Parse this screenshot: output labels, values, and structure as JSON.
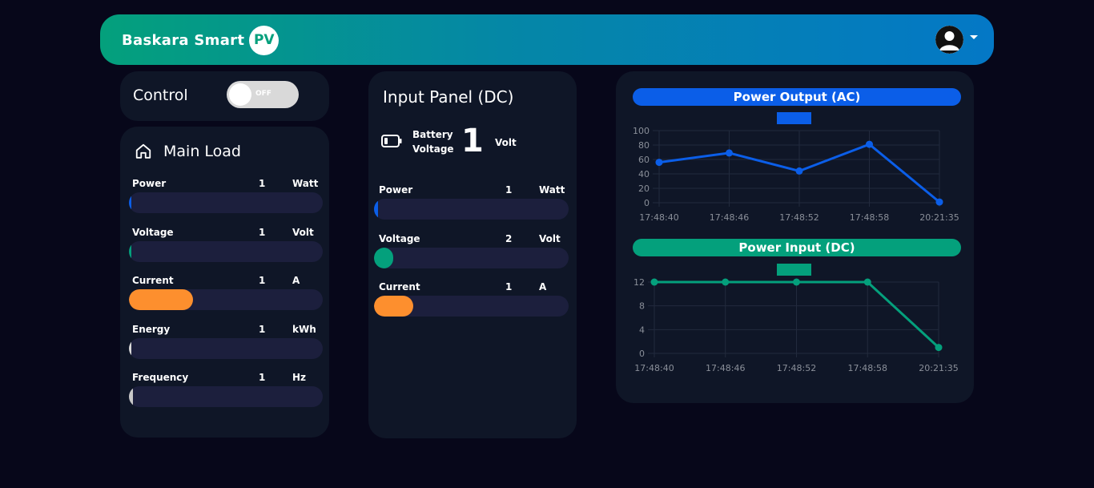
{
  "header": {
    "brand_text": "Baskara Smart",
    "brand_badge": "PV",
    "accent_start": "#04a07c",
    "accent_end": "#0478c6"
  },
  "control": {
    "title": "Control",
    "toggle_label": "OFF",
    "toggle_state": "off"
  },
  "main_load": {
    "title": "Main Load",
    "icon": "home-icon",
    "metrics": [
      {
        "label": "Power",
        "value": "1",
        "unit": "Watt",
        "level": 0.01,
        "color": "#0b5ee8"
      },
      {
        "label": "Voltage",
        "value": "1",
        "unit": "Volt",
        "level": 0.01,
        "color": "#04a07c"
      },
      {
        "label": "Current",
        "value": "1",
        "unit": "A",
        "level": 0.33,
        "color": "#fd8f2e"
      },
      {
        "label": "Energy",
        "value": "1",
        "unit": "kWh",
        "level": 0.01,
        "color": "#d9d9d9"
      },
      {
        "label": "Frequency",
        "value": "1",
        "unit": "Hz",
        "level": 0.02,
        "color": "#c8c8c8"
      }
    ]
  },
  "input_panel": {
    "title": "Input Panel (DC)",
    "battery_label_1": "Battery",
    "battery_label_2": "Voltage",
    "battery_value": "1",
    "battery_unit": "Volt",
    "metrics": [
      {
        "label": "Power",
        "value": "1",
        "unit": "Watt",
        "level": 0.02,
        "color": "#0b5ee8"
      },
      {
        "label": "Voltage",
        "value": "2",
        "unit": "Volt",
        "level": 0.1,
        "color": "#04a07c"
      },
      {
        "label": "Current",
        "value": "1",
        "unit": "A",
        "level": 0.2,
        "color": "#fd8f2e"
      }
    ]
  },
  "chart_data": [
    {
      "type": "line",
      "title": "Power Output (AC)",
      "x": [
        "17:48:40",
        "17:48:46",
        "17:48:52",
        "17:48:58",
        "20:21:35"
      ],
      "series": [
        {
          "values": [
            56,
            69,
            44,
            81,
            1
          ],
          "color": "#0b5ee8"
        }
      ],
      "ylim": [
        0,
        100
      ],
      "yticks": [
        0,
        20,
        40,
        60,
        80,
        100
      ],
      "grid": true,
      "legend": "top-center"
    },
    {
      "type": "line",
      "title": "Power Input (DC)",
      "x": [
        "17:48:40",
        "17:48:46",
        "17:48:52",
        "17:48:58",
        "20:21:35"
      ],
      "series": [
        {
          "values": [
            12,
            12,
            12,
            12,
            1
          ],
          "color": "#04a07c"
        }
      ],
      "ylim": [
        0,
        12
      ],
      "yticks": [
        0,
        4,
        8,
        12
      ],
      "grid": true,
      "legend": "top-center"
    }
  ]
}
